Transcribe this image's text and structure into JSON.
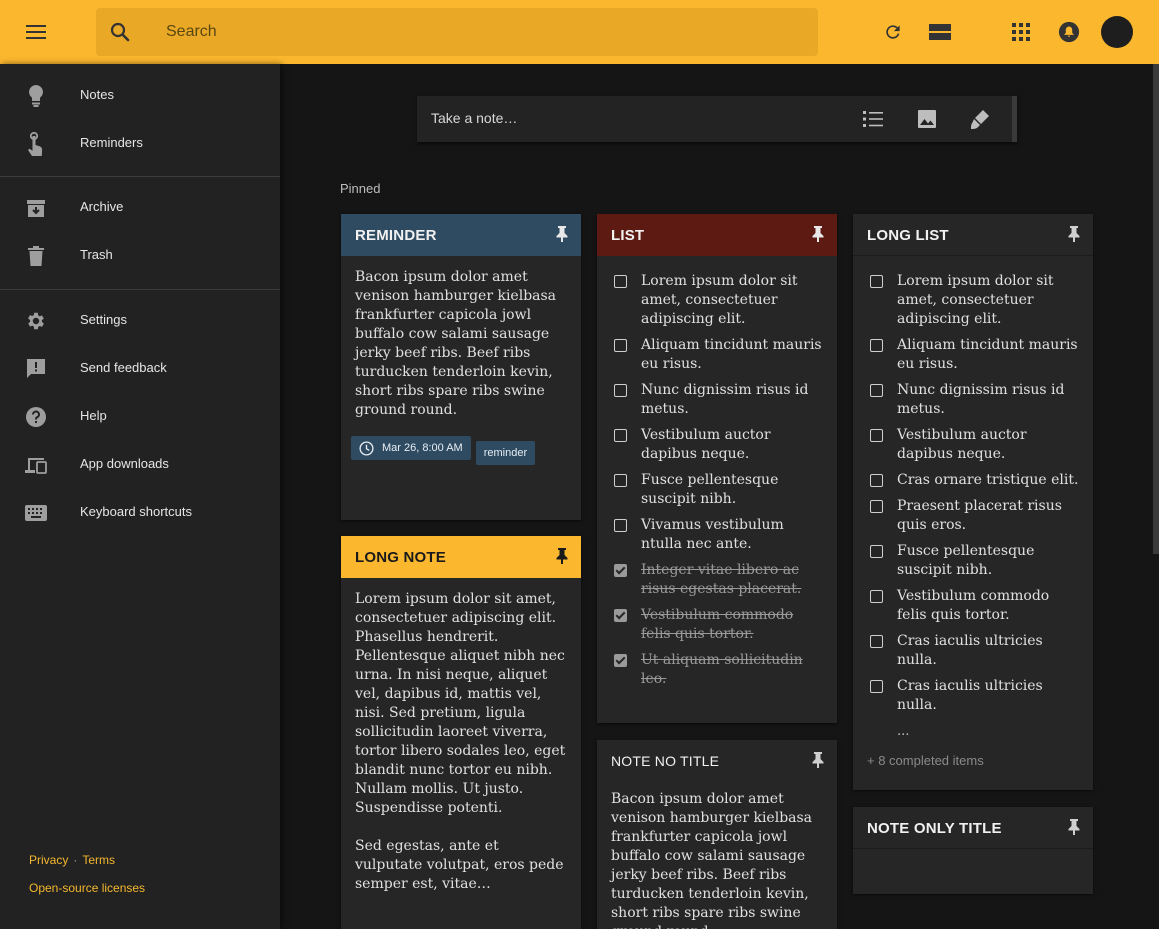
{
  "colors": {
    "topbar": "#fbb72e",
    "accent_blue": "#2e4b62",
    "accent_red": "#5c1a13",
    "accent_yellow": "#fbb72e",
    "card": "#262626"
  },
  "topbar": {
    "search_placeholder": "Search"
  },
  "sidebar": {
    "items": [
      {
        "label": "Notes",
        "icon": "lightbulb-icon"
      },
      {
        "label": "Reminders",
        "icon": "touch-icon"
      },
      {
        "label": "Archive",
        "icon": "archive-icon"
      },
      {
        "label": "Trash",
        "icon": "trash-icon"
      },
      {
        "label": "Settings",
        "icon": "gear-icon"
      },
      {
        "label": "Send feedback",
        "icon": "feedback-icon"
      },
      {
        "label": "Help",
        "icon": "help-icon"
      },
      {
        "label": "App downloads",
        "icon": "devices-icon"
      },
      {
        "label": "Keyboard shortcuts",
        "icon": "keyboard-icon"
      }
    ],
    "footer": {
      "privacy": "Privacy",
      "separator": "·",
      "terms": "Terms",
      "licenses": "Open-source licenses"
    }
  },
  "take_note": {
    "placeholder": "Take a note…"
  },
  "pinned_label": "Pinned",
  "cards": {
    "reminder": {
      "title": "REMINDER",
      "text": "Bacon ipsum dolor amet venison hamburger kielbasa frankfurter capicola jowl buffalo cow salami sausage jerky beef ribs. Beef ribs turducken tenderloin kevin, short ribs spare ribs swine ground round.",
      "chip_time": "Mar 26, 8:00 AM",
      "chip_label": "reminder"
    },
    "long_note": {
      "title": "LONG NOTE",
      "para1": "Lorem ipsum dolor sit amet, consectetuer adipiscing elit. Phasellus hendrerit. Pellentesque aliquet nibh nec urna. In nisi neque, aliquet vel, dapibus id, mattis vel, nisi. Sed pretium, ligula sollicitudin laoreet viverra, tortor libero sodales leo, eget blandit nunc tortor eu nibh. Nullam mollis. Ut justo. Suspendisse potenti.",
      "para2": "Sed egestas, ante et vulputate volutpat, eros pede semper est, vitae…"
    },
    "list": {
      "title": "LIST",
      "items": [
        {
          "text": "Lorem ipsum dolor sit amet, consectetuer adipiscing elit.",
          "done": false
        },
        {
          "text": "Aliquam tincidunt mauris eu risus.",
          "done": false
        },
        {
          "text": "Nunc dignissim risus id metus.",
          "done": false
        },
        {
          "text": "Vestibulum auctor dapibus neque.",
          "done": false
        },
        {
          "text": "Fusce pellentesque suscipit nibh.",
          "done": false
        },
        {
          "text": "Vivamus vestibulum ntulla nec ante.",
          "done": false
        },
        {
          "text": "Integer vitae libero ac risus egestas placerat.",
          "done": true
        },
        {
          "text": "Vestibulum commodo felis quis tortor.",
          "done": true
        },
        {
          "text": "Ut aliquam sollicitudin leo.",
          "done": true
        }
      ]
    },
    "note_no_title": {
      "title": "NOTE NO TITLE",
      "text": "Bacon ipsum dolor amet venison hamburger kielbasa frankfurter capicola jowl buffalo cow salami sausage jerky beef ribs. Beef ribs turducken tenderloin kevin, short ribs spare ribs swine ground round."
    },
    "long_list": {
      "title": "LONG LIST",
      "items": [
        {
          "text": "Lorem ipsum dolor sit amet, consectetuer adipiscing elit.",
          "done": false
        },
        {
          "text": "Aliquam tincidunt mauris eu risus.",
          "done": false
        },
        {
          "text": "Nunc dignissim risus id metus.",
          "done": false
        },
        {
          "text": "Vestibulum auctor dapibus neque.",
          "done": false
        },
        {
          "text": "Cras ornare tristique elit.",
          "done": false
        },
        {
          "text": "Praesent placerat risus quis eros.",
          "done": false
        },
        {
          "text": "Fusce pellentesque suscipit nibh.",
          "done": false
        },
        {
          "text": "Vestibulum commodo felis quis tortor.",
          "done": false
        },
        {
          "text": "Cras iaculis ultricies nulla.",
          "done": false
        },
        {
          "text": "Cras iaculis ultricies nulla.",
          "done": false
        }
      ],
      "ellipsis": "...",
      "completed": "+ 8 completed items"
    },
    "note_only_title": {
      "title": "NOTE ONLY TITLE"
    }
  }
}
